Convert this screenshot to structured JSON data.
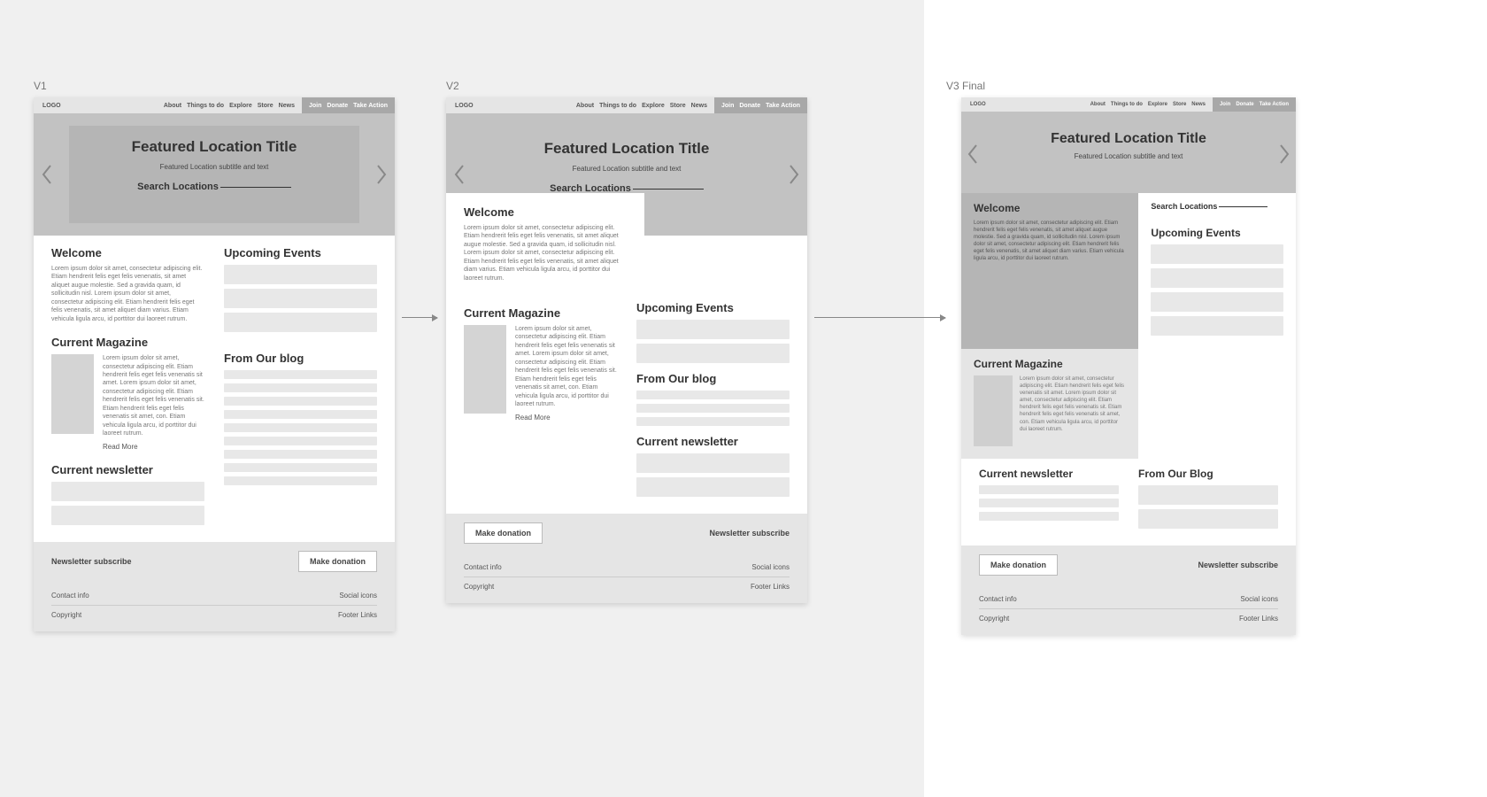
{
  "labels": {
    "v1": "V1",
    "v2": "V2",
    "v3": "V3 Final"
  },
  "nav": {
    "logo": "LOGO",
    "items": [
      "About",
      "Things to do",
      "Explore",
      "Store",
      "News"
    ],
    "cta": [
      "Join",
      "Donate",
      "Take Action"
    ]
  },
  "hero": {
    "title": "Featured Location Title",
    "subtitle": "Featured Location subtitle and text",
    "search_label": "Search Locations"
  },
  "sections": {
    "welcome": "Welcome",
    "welcome_body": "Lorem ipsum dolor sit amet, consectetur adipiscing elit. Etiam hendrerit felis eget felis venenatis, sit amet aliquet augue molestie. Sed a gravida quam, id sollicitudin nisl. Lorem ipsum dolor sit amet, consectetur adipiscing elit. Etiam hendrerit felis eget felis venenatis, sit amet aliquet diam varius. Etiam vehicula ligula arcu, id porttitor dui laoreet rutrum.",
    "events": "Upcoming Events",
    "magazine": "Current Magazine",
    "magazine_body": "Lorem ipsum dolor sit amet, consectetur adipiscing elit. Etiam hendrerit felis eget felis venenatis sit amet. Lorem ipsum dolor sit amet, consectetur adipiscing elit. Etiam hendrerit felis eget felis venenatis sit. Etiam hendrerit felis eget felis venenatis sit amet, con. Etiam vehicula ligula arcu, id porttitor dui laoreet rutrum.",
    "read_more": "Read More",
    "blog": "From Our blog",
    "blog_caps": "From Our Blog",
    "newsletter": "Current newsletter"
  },
  "cta_row": {
    "donate": "Make donation",
    "subscribe": "Newsletter subscribe"
  },
  "footer": {
    "contact": "Contact info",
    "social": "Social icons",
    "copyright": "Copyright",
    "links": "Footer Links"
  }
}
